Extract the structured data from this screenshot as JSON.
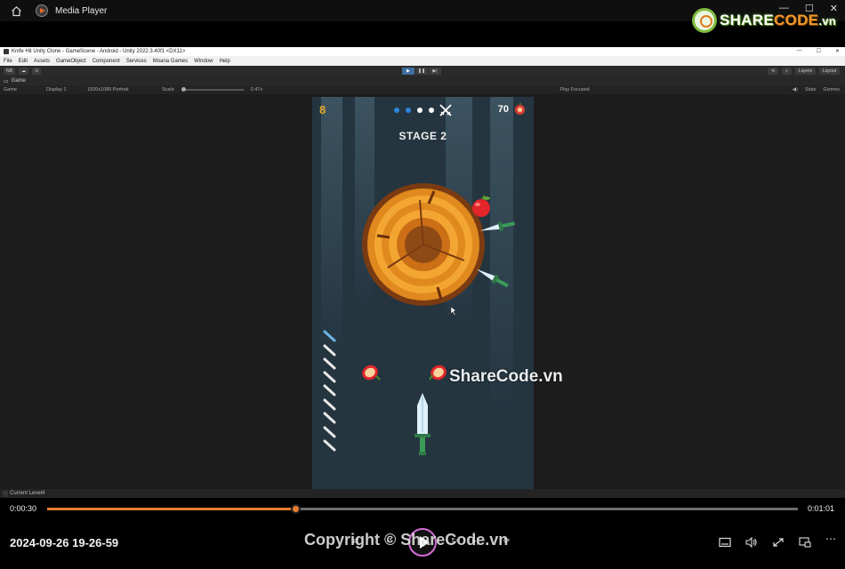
{
  "media_player": {
    "title": "Media Player",
    "window_controls": [
      "—",
      "☐",
      "✕"
    ],
    "logo": {
      "prefix": "SHARE",
      "suffix": "CODE",
      "domain": ".vn"
    },
    "watermark": "ShareCode.vn",
    "copyright": "Copyright © ShareCode.vn",
    "clip_title": "2024-09-26 19-26-59",
    "current_time": "0:00:30",
    "total_time": "0:01:01",
    "progress": 0.33,
    "colors": {
      "accent": "#e97c2e",
      "play_ring": "#d46dd6"
    }
  },
  "unity": {
    "window_title": "Knife Hit Unity Clone - GameScene - Android - Unity 2022.3.40f1 <DX11>",
    "window_controls": [
      "—",
      "☐",
      "✕"
    ],
    "menu": [
      "File",
      "Edit",
      "Assets",
      "GameObject",
      "Component",
      "Services",
      "Moana Games",
      "Window",
      "Help"
    ],
    "toolbar": {
      "account": "NB",
      "layers_label": "Layers",
      "layout_label": "Layout"
    },
    "tab": "Game",
    "gamebar": {
      "view": "Game",
      "display": "Display 1",
      "resolution": "1920x1080 Portrait",
      "scale_label": "Scale",
      "scale_value": "0.47x",
      "play_focused": "Play Focused",
      "stats": "Stats",
      "gizmos": "Gizmos"
    },
    "status_text": "Current Level4"
  },
  "game": {
    "knives_left_count": "8",
    "apple_score": "70",
    "stage_label": "STAGE 2",
    "stage_dots": [
      "#2f86d8",
      "#2f86d8",
      "#ffffff",
      "#ffffff"
    ],
    "colors": {
      "background": "#243540",
      "count": "#e5a928",
      "log_outer": "#7a3b12",
      "log_ring": "#e0891e"
    }
  }
}
